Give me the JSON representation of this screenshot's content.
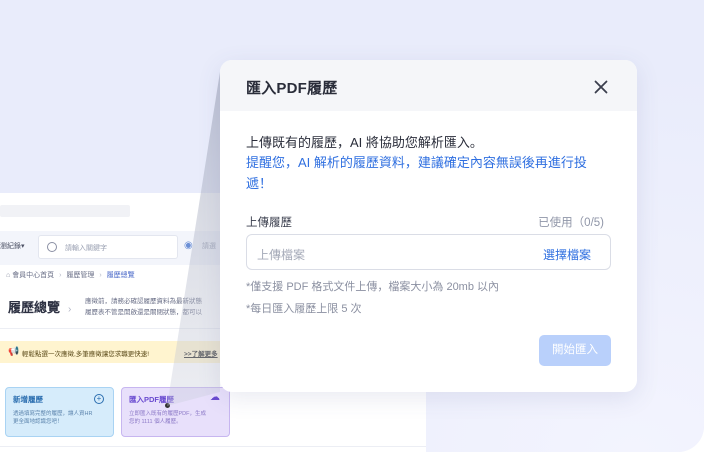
{
  "modal": {
    "title": "匯入PDF履歷",
    "intro": "上傳既有的履歷，AI 將協助您解析匯入。",
    "warning": "提醒您，AI 解析的履歷資料，建議確定內容無誤後再進行投遞！",
    "upload_label": "上傳履歷",
    "usage": "已使用（0/5)",
    "upload_placeholder": "上傳檔案",
    "choose_file": "選擇檔案",
    "note_format": "*僅支援 PDF 格式文件上傳，檔案大小為 20mb 以內",
    "note_limit": "*每日匯入履歷上限 5 次",
    "start_button": "開始匯入",
    "start_enabled": false
  },
  "background_site": {
    "history_label": "瀏紀錄▾",
    "search_placeholder": "請輸入關鍵字",
    "location_placeholder": "請選",
    "breadcrumb": [
      "會員中心首頁",
      "履歷管理",
      "履歷總覽"
    ],
    "page_title": "履歷總覽",
    "page_desc_line1": "應徵前，請務必確認履歷資料為最新狀態",
    "page_desc_line2": "履歷表不管是開啟還是關閉狀態，都可以",
    "notice_text": "輕鬆點選一次應徵,多筆應徵讓您求職更快速!",
    "notice_link": ">>了解更多",
    "cards": [
      {
        "title": "新增履歷",
        "desc_line1": "透過填寫完整的履歷，讓人資HR",
        "desc_line2": "更全面地認識您吧！"
      },
      {
        "title": "匯入PDF履歷",
        "desc_line1": "立即匯入既有的履歷PDF，生成",
        "desc_line2": "您的 1111 個人履歷。"
      }
    ]
  },
  "colors": {
    "accent": "#2f6fe0",
    "button_disabled": "#b9d0fb",
    "backdrop": "#e9ecfb"
  }
}
